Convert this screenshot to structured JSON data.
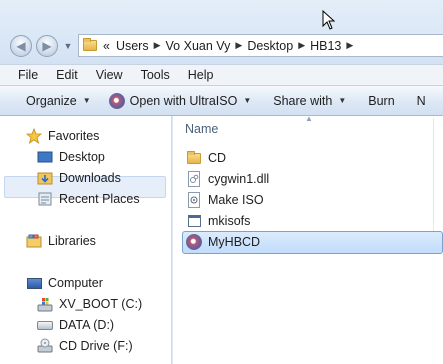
{
  "address": {
    "overflow": "«",
    "segments": [
      "Users",
      "Vo Xuan Vy",
      "Desktop",
      "HB13"
    ]
  },
  "menu": [
    "File",
    "Edit",
    "View",
    "Tools",
    "Help"
  ],
  "toolbar": {
    "organize": "Organize",
    "open_with": "Open with UltraISO",
    "share_with": "Share with",
    "burn": "Burn",
    "next_cut": "N"
  },
  "nav": {
    "favorites": "Favorites",
    "desktop": "Desktop",
    "downloads": "Downloads",
    "recent": "Recent Places",
    "libraries": "Libraries",
    "computer": "Computer",
    "drive_c": "XV_BOOT (C:)",
    "drive_d": "DATA (D:)",
    "drive_f": "CD Drive (F:)"
  },
  "files": {
    "column_name": "Name",
    "items": [
      "CD",
      "cygwin1.dll",
      "Make ISO",
      "mkisofs",
      "MyHBCD"
    ]
  }
}
